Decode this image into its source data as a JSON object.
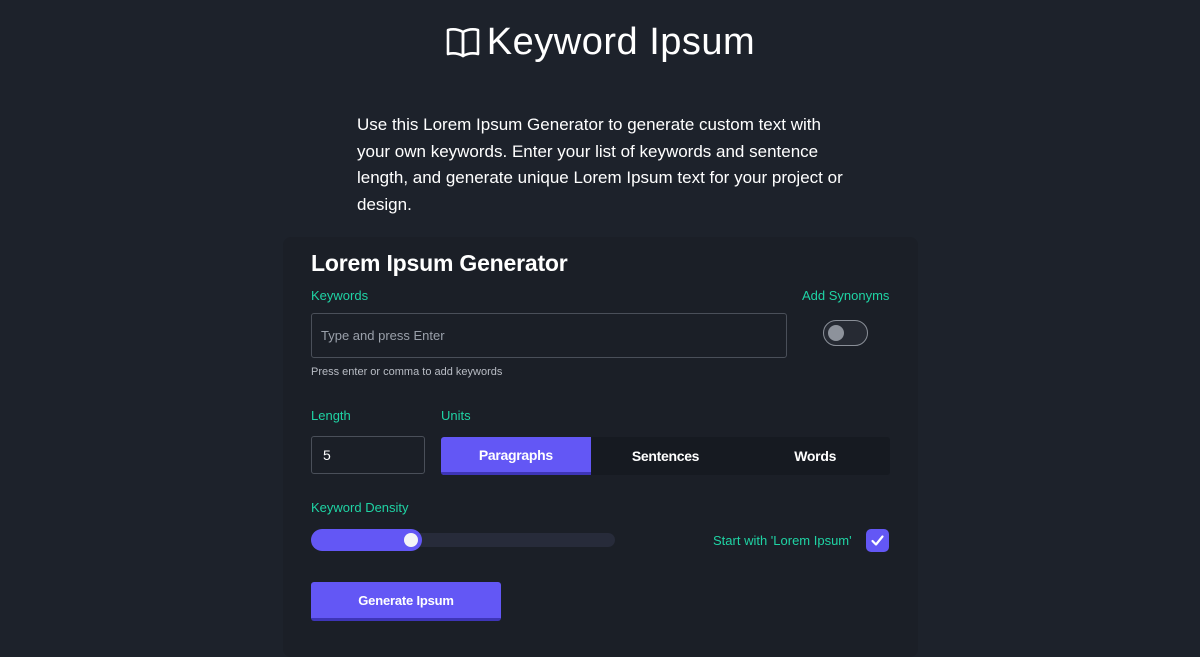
{
  "brand": {
    "title": "Keyword Ipsum",
    "icon": "open-book-icon"
  },
  "intro": "Use this Lorem Ipsum Generator to generate custom text with your own keywords. Enter your list of keywords and sentence length, and generate unique Lorem Ipsum text for your project or design.",
  "generator": {
    "title": "Lorem Ipsum Generator",
    "keywords_label": "Keywords",
    "keywords_placeholder": "Type and press Enter",
    "keywords_value": "",
    "keywords_hint": "Press enter or comma to add keywords",
    "synonyms_label": "Add Synonyms",
    "synonyms_enabled": false,
    "length_label": "Length",
    "length_value": "5",
    "units_label": "Units",
    "units": [
      {
        "label": "Paragraphs",
        "active": true
      },
      {
        "label": "Sentences",
        "active": false
      },
      {
        "label": "Words",
        "active": false
      }
    ],
    "density_label": "Keyword Density",
    "density_fraction": 0.33,
    "start_label": "Start with 'Lorem Ipsum'",
    "start_checked": true,
    "generate_label": "Generate Ipsum"
  },
  "colors": {
    "background": "#1d222b",
    "card": "#1b1f27",
    "accent": "#6357f5",
    "label_green": "#1fd3a4"
  }
}
